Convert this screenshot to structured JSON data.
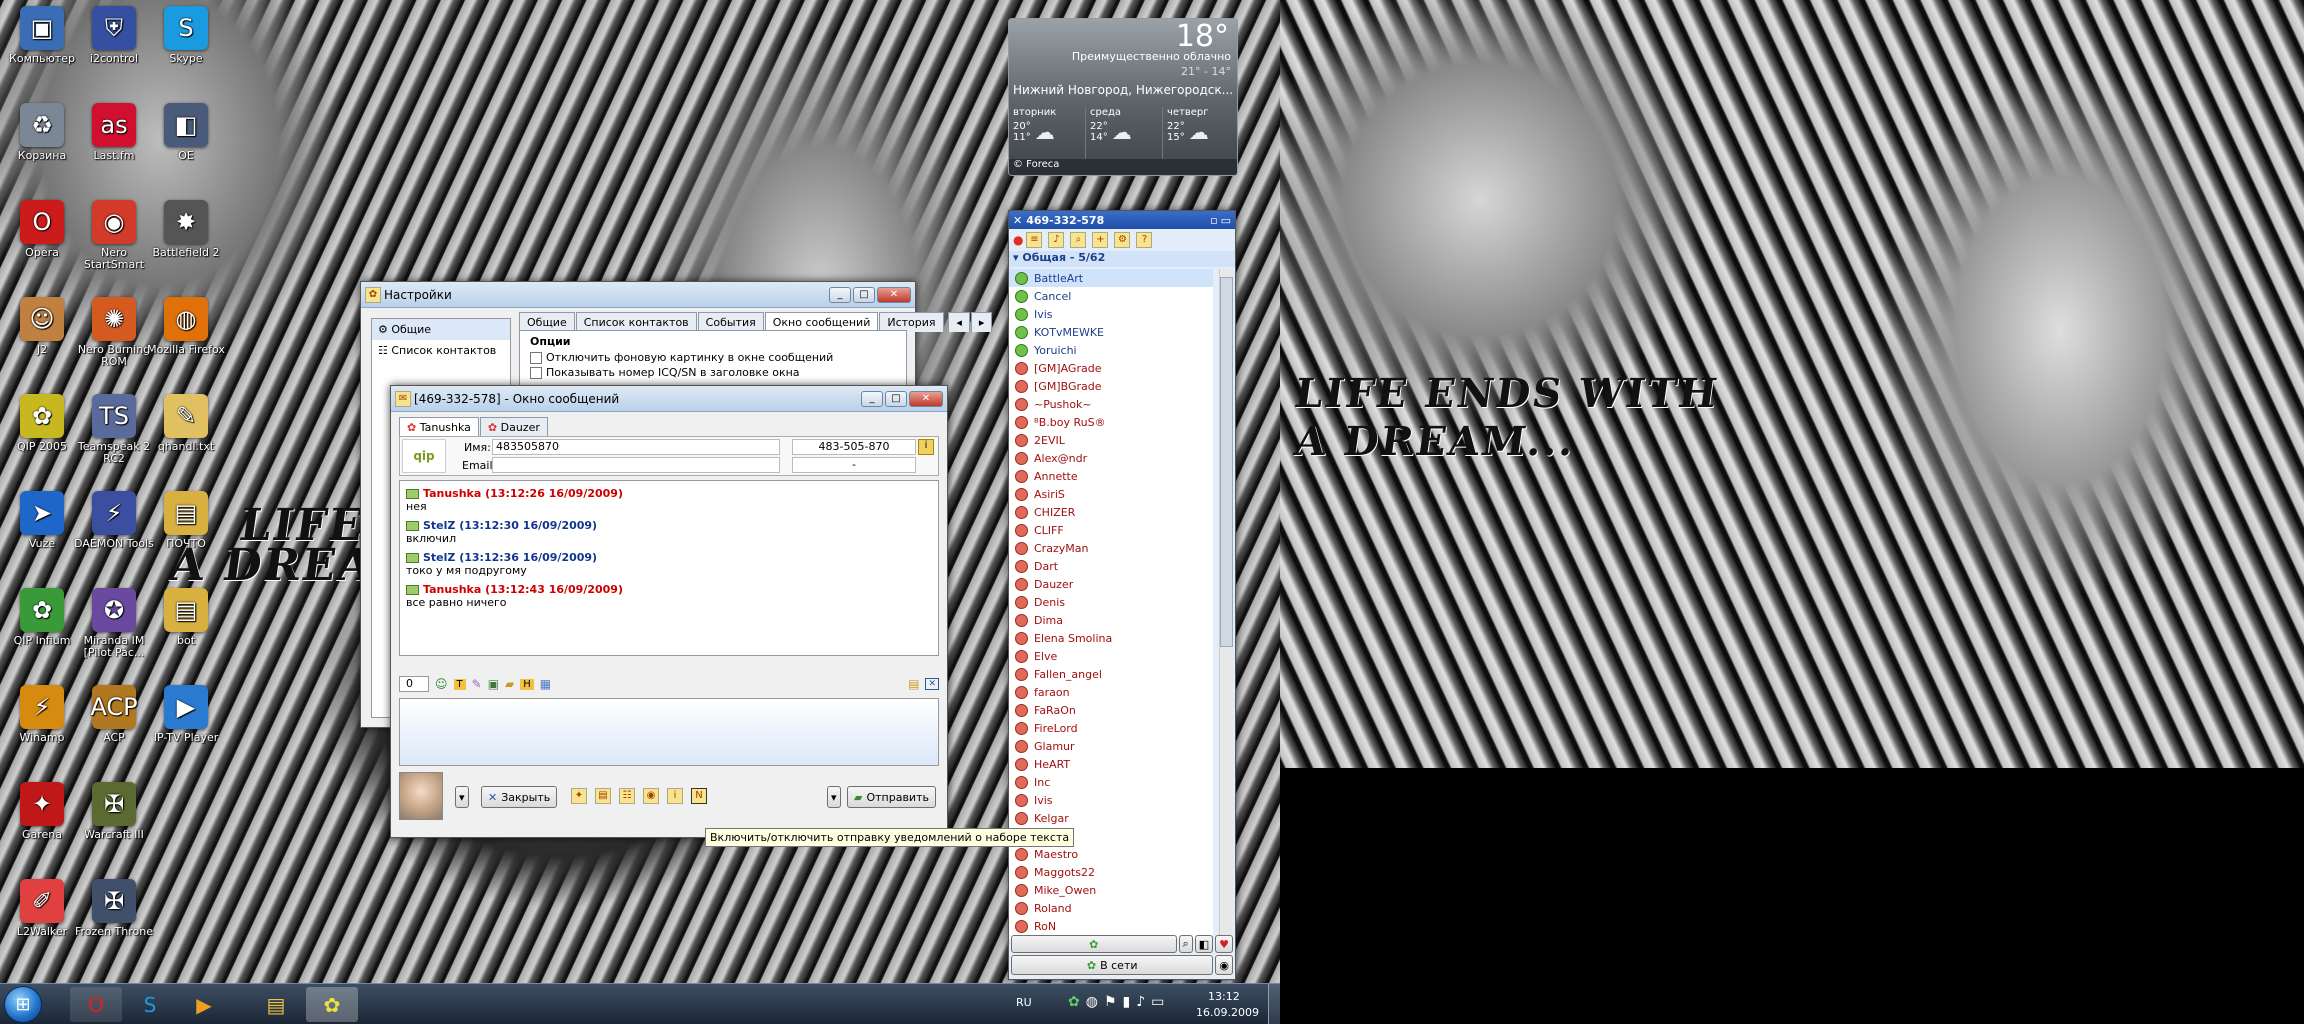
{
  "desktop_icons": [
    {
      "label": "Компьютер",
      "glyph": "▣",
      "color": "#3a6db5"
    },
    {
      "label": "i2control",
      "glyph": "⛨",
      "color": "#3550a0"
    },
    {
      "label": "Skype",
      "glyph": "S",
      "color": "#1a9be0"
    },
    {
      "label": "Корзина",
      "glyph": "♻",
      "color": "#7b8794"
    },
    {
      "label": "Last.fm",
      "glyph": "as",
      "color": "#d0102e"
    },
    {
      "label": "ОЕ",
      "glyph": "◧",
      "color": "#4a5a7a"
    },
    {
      "label": "Opera",
      "glyph": "O",
      "color": "#cc1b1b"
    },
    {
      "label": "Nero StartSmart",
      "glyph": "◉",
      "color": "#d23a2a"
    },
    {
      "label": "Battlefield 2",
      "glyph": "✸",
      "color": "#555"
    },
    {
      "label": "J2",
      "glyph": "☺",
      "color": "#c08040"
    },
    {
      "label": "Nero Burning ROM",
      "glyph": "✺",
      "color": "#d55a20"
    },
    {
      "label": "Mozilla Firefox",
      "glyph": "◍",
      "color": "#e0700a"
    },
    {
      "label": "QIP 2005",
      "glyph": "✿",
      "color": "#c8b820"
    },
    {
      "label": "Teamspeak 2 RC2",
      "glyph": "TS",
      "color": "#5a6a9a"
    },
    {
      "label": "qhandl.txt",
      "glyph": "✎",
      "color": "#e0c060"
    },
    {
      "label": "Vuze",
      "glyph": "➤",
      "color": "#1f66c9"
    },
    {
      "label": "DAEMON Tools",
      "glyph": "⚡",
      "color": "#3b4fa0"
    },
    {
      "label": "ПОЧТО",
      "glyph": "▤",
      "color": "#d8b040"
    },
    {
      "label": "QIP Infium",
      "glyph": "✿",
      "color": "#3a9a3a"
    },
    {
      "label": "Miranda IM [Pilot Pac...",
      "glyph": "✪",
      "color": "#6a4aa0"
    },
    {
      "label": "bot",
      "glyph": "▤",
      "color": "#d8b040"
    },
    {
      "label": "Winamp",
      "glyph": "⚡",
      "color": "#d68a10"
    },
    {
      "label": "ACP",
      "glyph": "ACP",
      "color": "#b07820"
    },
    {
      "label": "IP-TV Player",
      "glyph": "▶",
      "color": "#2a7ad0"
    },
    {
      "label": "Garena",
      "glyph": "✦",
      "color": "#c01818"
    },
    {
      "label": "Warcraft III",
      "glyph": "✠",
      "color": "#5a6a30"
    },
    {
      "label": "",
      "glyph": "",
      "color": "transparent"
    },
    {
      "label": "L2Walker",
      "glyph": "✐",
      "color": "#e04040"
    },
    {
      "label": "Frozen Throne",
      "glyph": "✠",
      "color": "#40506a"
    }
  ],
  "wallpaper": {
    "text1": "LIFE ENDS WITH",
    "text2": "A DREAM...",
    "text3": "LIFE ENDS",
    "text4": "A DREAM"
  },
  "weather": {
    "temp": "18°",
    "condition": "Преимущественно облачно",
    "range": "21° - 14°",
    "location": "Нижний Новгород, Нижегородск...",
    "days": [
      {
        "name": "вторник",
        "hi": "20°",
        "lo": "11°"
      },
      {
        "name": "среда",
        "hi": "22°",
        "lo": "14°"
      },
      {
        "name": "четверг",
        "hi": "22°",
        "lo": "15°"
      }
    ],
    "source": "© Foreca"
  },
  "settings": {
    "title": "Настройки",
    "nav": [
      "Общие",
      "Список контактов"
    ],
    "tabs": [
      "Общие",
      "Список контактов",
      "События",
      "Окно сообщений",
      "История"
    ],
    "section": "Опции",
    "options": [
      "Отключить фоновую картинку в окне сообщений",
      "Показывать номер ICQ/SN в заголовке окна"
    ]
  },
  "chat": {
    "title": "[469-332-578] - Окно сообщений",
    "tabs": [
      "Tanushka",
      "Dauzer"
    ],
    "name_label": "Имя:",
    "name_value": "483505870",
    "uin_value": "483-505-870",
    "email_label": "Email:",
    "email_value": "-",
    "messages": [
      {
        "head": "Tanushka (13:12:26 16/09/2009)",
        "text": "нея",
        "who": "red"
      },
      {
        "head": "StelZ (13:12:30 16/09/2009)",
        "text": "включил",
        "who": "blue"
      },
      {
        "head": "StelZ (13:12:36 16/09/2009)",
        "text": "токо у мя подругому",
        "who": "blue"
      },
      {
        "head": "Tanushka (13:12:43 16/09/2009)",
        "text": "все равно ничего",
        "who": "red"
      }
    ],
    "counter": "0",
    "close_label": "Закрыть",
    "send_label": "Отправить",
    "tooltip": "Включить/отключить отправку уведомлений о наборе текста"
  },
  "clist": {
    "uin": "469-332-578",
    "group": "Общая - 5/62",
    "contacts": [
      {
        "name": "BattleArt",
        "online": true,
        "selected": true
      },
      {
        "name": "Cancel",
        "online": true
      },
      {
        "name": "Ivis",
        "online": true
      },
      {
        "name": "KOTvMEWKE",
        "online": true
      },
      {
        "name": "Yoruichi",
        "online": true
      },
      {
        "name": "[GM]AGrade",
        "online": false
      },
      {
        "name": "[GM]BGrade",
        "online": false
      },
      {
        "name": "~Pushok~",
        "online": false
      },
      {
        "name": "ᴮB.boy RuS®",
        "online": false
      },
      {
        "name": "2EVIL",
        "online": false
      },
      {
        "name": "Alex@ndr",
        "online": false
      },
      {
        "name": "Annette",
        "online": false
      },
      {
        "name": "AsiriS",
        "online": false
      },
      {
        "name": "CHIZER",
        "online": false
      },
      {
        "name": "CLIFF",
        "online": false
      },
      {
        "name": "CrazyMan",
        "online": false
      },
      {
        "name": "Dart",
        "online": false
      },
      {
        "name": "Dauzer",
        "online": false
      },
      {
        "name": "Denis",
        "online": false
      },
      {
        "name": "Dima",
        "online": false
      },
      {
        "name": "Elena Smolina",
        "online": false
      },
      {
        "name": "Elve",
        "online": false
      },
      {
        "name": "Fallen_angel",
        "online": false
      },
      {
        "name": "faraon",
        "online": false
      },
      {
        "name": "FaRaOn",
        "online": false
      },
      {
        "name": "FireLord",
        "online": false
      },
      {
        "name": "Glamur",
        "online": false
      },
      {
        "name": "HeART",
        "online": false
      },
      {
        "name": "Inc",
        "online": false
      },
      {
        "name": "Ivis",
        "online": false
      },
      {
        "name": "Kelgar",
        "online": false
      },
      {
        "name": "ng",
        "online": false
      },
      {
        "name": "Maestro",
        "online": false
      },
      {
        "name": "Maggots22",
        "online": false
      },
      {
        "name": "Mike_Owen",
        "online": false
      },
      {
        "name": "Roland",
        "online": false
      },
      {
        "name": "RoN",
        "online": false
      }
    ],
    "status": "В сети"
  },
  "taskbar": {
    "lang": "RU",
    "time": "13:12",
    "date": "16.09.2009"
  }
}
